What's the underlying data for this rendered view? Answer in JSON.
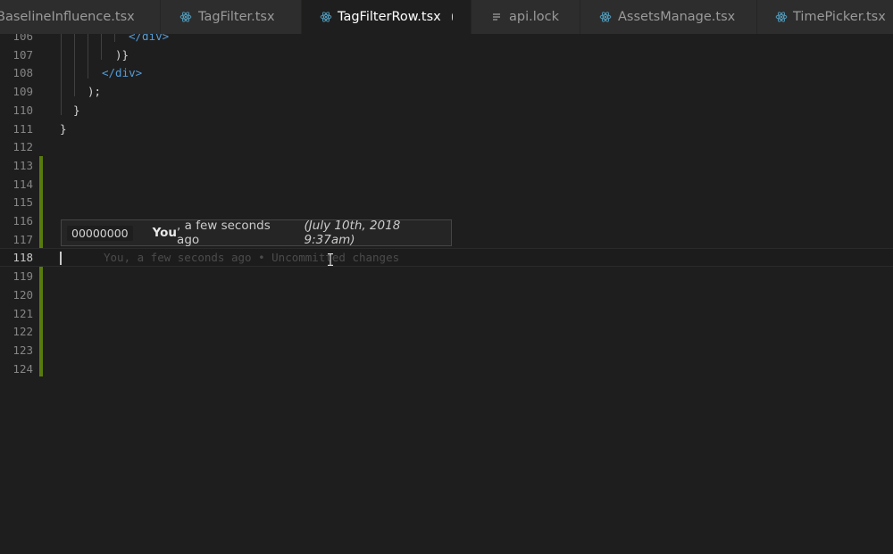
{
  "tabs": [
    {
      "label": "BaselineInfluence.tsx",
      "icon": "none",
      "active": false
    },
    {
      "label": "TagFilter.tsx",
      "icon": "react-icon",
      "active": false
    },
    {
      "label": "TagFilterRow.tsx",
      "icon": "react-icon",
      "active": true
    },
    {
      "label": "api.lock",
      "icon": "file-lines-icon",
      "active": false
    },
    {
      "label": "AssetsManage.tsx",
      "icon": "react-icon",
      "active": false
    },
    {
      "label": "TimePicker.tsx",
      "icon": "react-icon",
      "active": false
    }
  ],
  "editor": {
    "line_numbers": [
      "106",
      "107",
      "108",
      "109",
      "110",
      "111",
      "112",
      "113",
      "114",
      "115",
      "116",
      "117",
      "118",
      "119",
      "120",
      "121",
      "122",
      "123",
      "124"
    ],
    "current_line": "118",
    "code": {
      "l106": "</div>",
      "l107": ")}",
      "l108": "</div>",
      "l109": ");",
      "l110": "}",
      "l111": "}"
    },
    "inline_blame": "You, a few seconds ago • Uncommitted changes"
  },
  "hover": {
    "sha": "00000000",
    "author": "You",
    "relative_time": ", a few seconds ago",
    "date": "(July 10th, 2018 9:37am)"
  },
  "colors": {
    "added_gutter": "#587c0c",
    "tag": "#569cd6",
    "react_icon": "#519aba"
  }
}
